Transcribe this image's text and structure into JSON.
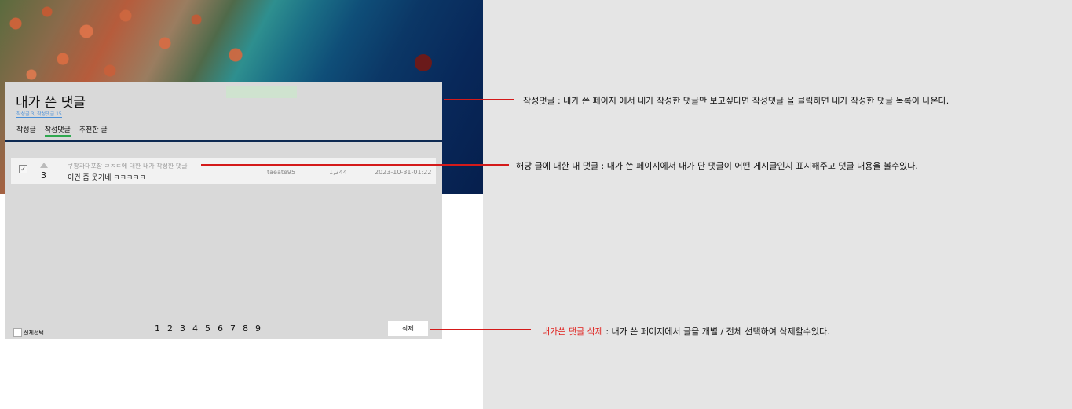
{
  "page": {
    "title": "내가 쓴 댓글",
    "summary": "작성글 3, 작성댓글 15",
    "tabs": [
      {
        "label": "작성글",
        "active": false
      },
      {
        "label": "작성댓글",
        "active": true
      },
      {
        "label": "추천한 글",
        "active": false
      }
    ]
  },
  "comments": [
    {
      "checked": true,
      "vote_icon": "triangle-up-icon",
      "votes": "3",
      "post_ref": "쿠팡과대포장 ㄹㅈㄷ에 대한 내가 작성한 댓글",
      "content": "이건 좀 웃기네 ㅋㅋㅋㅋㅋ",
      "author": "taeate95",
      "views": "1,244",
      "date": "2023-10-31-01:22"
    }
  ],
  "footer": {
    "select_all_label": "전체선택",
    "pages": [
      "1",
      "2",
      "3",
      "4",
      "5",
      "6",
      "7",
      "8",
      "9"
    ],
    "delete_label": "삭제"
  },
  "annotations": {
    "a1": "작성댓글 : 내가 쓴 페이지 에서 내가 작성한 댓글만 보고싶다면  작성댓글 을 클릭하면 내가 작성한 댓글 목록이 나온다.",
    "a2": "해당 글에 대한 내 댓글 : 내가 쓴 페이지에서 내가 단 댓글이 어떤 게시글인지 표시해주고 댓글 내용을 볼수있다.",
    "a3_red": "내가쓴 댓글 삭제",
    "a3_rest": " : 내가 쓴 페이지에서 글을 개별 / 전체 선택하여 삭제할수있다."
  },
  "colors": {
    "accent_tab": "#2fa84f",
    "annotation_line": "#d41a1a",
    "highlight_text": "#e0201d",
    "panel": "#d9d9d9"
  }
}
